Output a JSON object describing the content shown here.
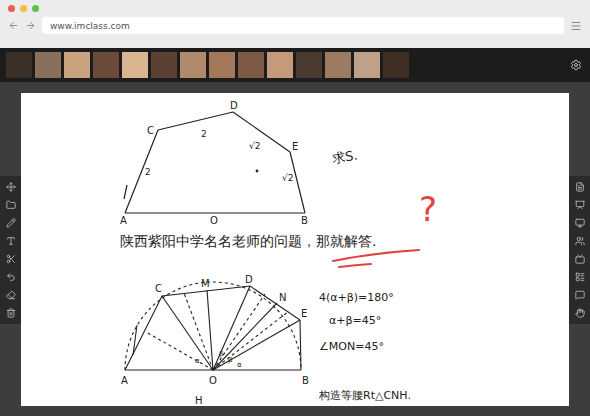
{
  "browser": {
    "url": "www.imclass.com"
  },
  "participants": [
    {
      "color": "#3b3028"
    },
    {
      "color": "#8a6f5c"
    },
    {
      "color": "#c9a27e"
    },
    {
      "color": "#6b4a3a"
    },
    {
      "color": "#d8b48f"
    },
    {
      "color": "#5a4033"
    },
    {
      "color": "#b08a6a"
    },
    {
      "color": "#a3785a"
    },
    {
      "color": "#7d5a45"
    },
    {
      "color": "#c49a7a"
    },
    {
      "color": "#4a3a30"
    },
    {
      "color": "#9c7b62"
    },
    {
      "color": "#bfa088"
    },
    {
      "color": "#3f2e24"
    }
  ],
  "whiteboard": {
    "figure_top": {
      "vertices": [
        "A",
        "O",
        "B",
        "C",
        "D",
        "E"
      ],
      "side_labels": [
        "2",
        "2",
        "√2",
        "√2"
      ]
    },
    "question": "求S.",
    "problem_note": "陕西紫阳中学名名老师的问题，那就解答.",
    "annotation": "?",
    "figure_bottom": {
      "vertices": [
        "A",
        "O",
        "B",
        "C",
        "M",
        "D",
        "N",
        "E",
        "H"
      ],
      "angle_labels": [
        "α",
        "β",
        "β",
        "α"
      ]
    },
    "equations": [
      "4(α+β)=180°",
      "α+β=45°",
      "∠MON=45°"
    ],
    "construction": "构造等腰Rt△CNH."
  }
}
